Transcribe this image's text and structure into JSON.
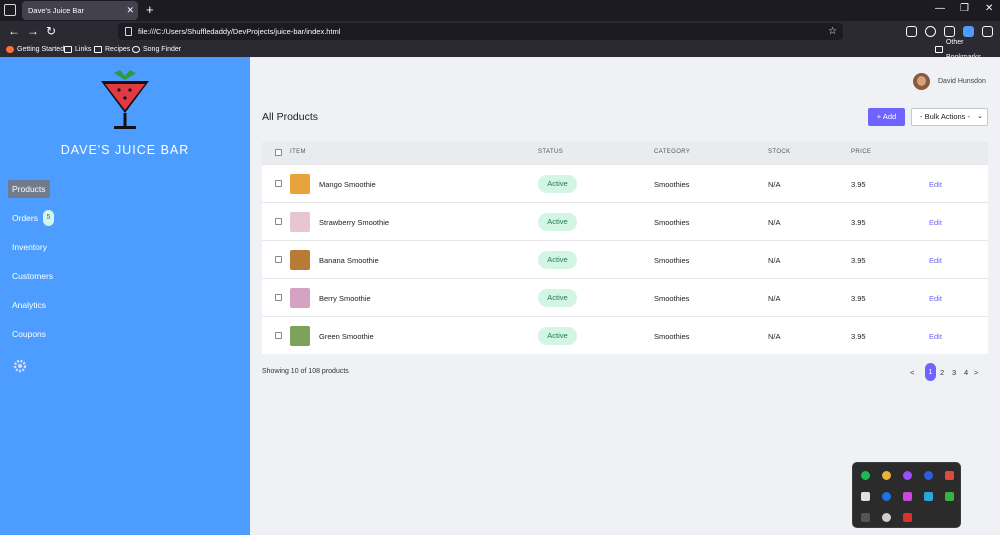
{
  "browser": {
    "tab_title": "Dave's Juice Bar",
    "tab_close": "✕",
    "new_tab": "+",
    "url": "file:///C:/Users/Shuffledaddy/DevProjects/juice-bar/index.html",
    "window_controls": [
      "—",
      "❐",
      "✕"
    ],
    "bookmarks": [
      {
        "label": "Getting Started",
        "icon": "firefox-icon"
      },
      {
        "label": "Links",
        "icon": "folder-icon"
      },
      {
        "label": "Recipes",
        "icon": "folder-icon"
      },
      {
        "label": "Song Finder",
        "icon": "globe-icon"
      }
    ],
    "other_bookmarks": "Other Bookmarks"
  },
  "sidebar": {
    "brand": "DAVE'S JUICE BAR",
    "items": [
      {
        "label": "Products",
        "active": true
      },
      {
        "label": "Orders",
        "badge": "5"
      },
      {
        "label": "Inventory"
      },
      {
        "label": "Customers"
      },
      {
        "label": "Analytics"
      },
      {
        "label": "Coupons"
      }
    ],
    "accent": "#4c9dff"
  },
  "header": {
    "user_name": "David Hunsdon",
    "page_title": "All Products",
    "add_label": "+ Add",
    "bulk_actions_label": "- Bulk Actions -"
  },
  "table": {
    "columns": [
      "ITEM",
      "STATUS",
      "CATEGORY",
      "STOCK",
      "PRICE"
    ],
    "rows": [
      {
        "item": "Mango Smoothie",
        "status": "Active",
        "category": "Smoothies",
        "stock": "N/A",
        "price": "3.95",
        "action": "Edit",
        "thumb": "#e8a23a"
      },
      {
        "item": "Strawberry Smoothie",
        "status": "Active",
        "category": "Smoothies",
        "stock": "N/A",
        "price": "3.95",
        "action": "Edit",
        "thumb": "#e8c6cf"
      },
      {
        "item": "Banana Smoothie",
        "status": "Active",
        "category": "Smoothies",
        "stock": "N/A",
        "price": "3.95",
        "action": "Edit",
        "thumb": "#b87a34"
      },
      {
        "item": "Berry Smoothie",
        "status": "Active",
        "category": "Smoothies",
        "stock": "N/A",
        "price": "3.95",
        "action": "Edit",
        "thumb": "#d6a2c2"
      },
      {
        "item": "Green Smoothie",
        "status": "Active",
        "category": "Smoothies",
        "stock": "N/A",
        "price": "3.95",
        "action": "Edit",
        "thumb": "#7fa25a"
      }
    ]
  },
  "footer": {
    "showing_text": "Showing 10 of 108 products",
    "pagination": {
      "prev": "<",
      "pages": [
        "1",
        "2",
        "3",
        "4"
      ],
      "current": "1",
      "next": ">"
    }
  },
  "colors": {
    "primary": "#6e64ff",
    "status_bg": "#d3f5e4",
    "status_text": "#1f7a52"
  }
}
